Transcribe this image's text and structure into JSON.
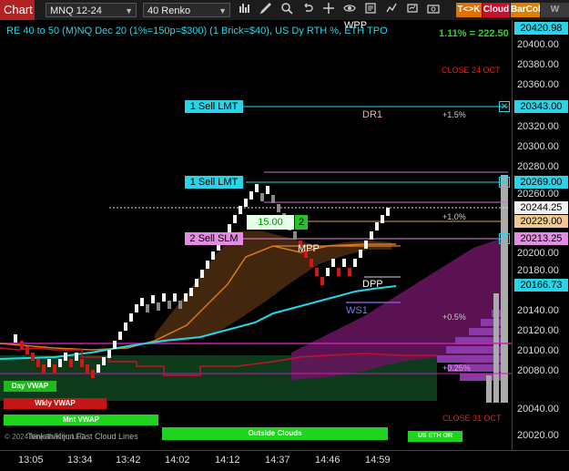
{
  "toolbar": {
    "chart_tab": "Chart",
    "instrument": "MNQ 12-24",
    "bar_type": "40 Renko",
    "buttons": [
      "T<>K",
      "Cloud",
      "BarCol",
      "W VWA"
    ],
    "colors": {
      "tk": "#e07000",
      "cloud": "#c8102e",
      "barcol": "#e08000",
      "vwa": "#3a3a3a"
    }
  },
  "header": {
    "description": "RE 40 to 50 (M)NQ Dec 20 (1%=150p=$300) (1 Brick=$40), US Dy RTH %, ETH TPO",
    "change": "1.11% = 222.50",
    "wpp": "WPP"
  },
  "annotations": {
    "close_24": "CLOSE 24 OCT",
    "close_31": "CLOSE 31 OCT",
    "dr1": "DR1",
    "mpp": "MPP",
    "dpp": "DPP",
    "ws1": "WS1",
    "pct_15": "+1.5%",
    "pct_10": "+1.0%",
    "pct_05": "+0.5%",
    "pct_025": "+0.25%",
    "cloud_label": "Tenkan/Kijun Fast Cloud Lines",
    "copyright": "© 2024 NinjaTrader, LLC"
  },
  "orders": [
    {
      "label": "1 Sell LMT",
      "price": "20343.00",
      "color": "#2ad4e8"
    },
    {
      "label": "1 Sell LMT",
      "price": "20269.00",
      "color": "#2ad4e8"
    },
    {
      "label": "2 Sell SLM",
      "price": "20213.25",
      "color": "#e58be6"
    }
  ],
  "position": {
    "qty_text": "15.00",
    "qty": "2"
  },
  "price_labels": {
    "last": "20244.25",
    "stop": "20229.00",
    "vwap": "20166.73",
    "top": "20420.98"
  },
  "price_axis": [
    "20400.00",
    "20380.00",
    "20360.00",
    "20320.00",
    "20300.00",
    "20280.00",
    "20260.00",
    "20200.00",
    "20180.00",
    "20140.00",
    "20120.00",
    "20100.00",
    "20080.00",
    "20040.00",
    "20020.00"
  ],
  "time_axis": [
    "13:05",
    "13:34",
    "13:42",
    "14:02",
    "14:12",
    "14:37",
    "14:46",
    "14:59"
  ],
  "status_bars": [
    {
      "label": "Day VWAP",
      "color": "#1fb81f"
    },
    {
      "label": "Wkly VWAP",
      "color": "#c41616"
    },
    {
      "label": "Mnt VWAP",
      "color": "#1fd41f"
    },
    {
      "label": "Outside Clouds",
      "color": "#1fd41f"
    },
    {
      "label": "US ETH OR",
      "color": "#1fd41f"
    }
  ]
}
